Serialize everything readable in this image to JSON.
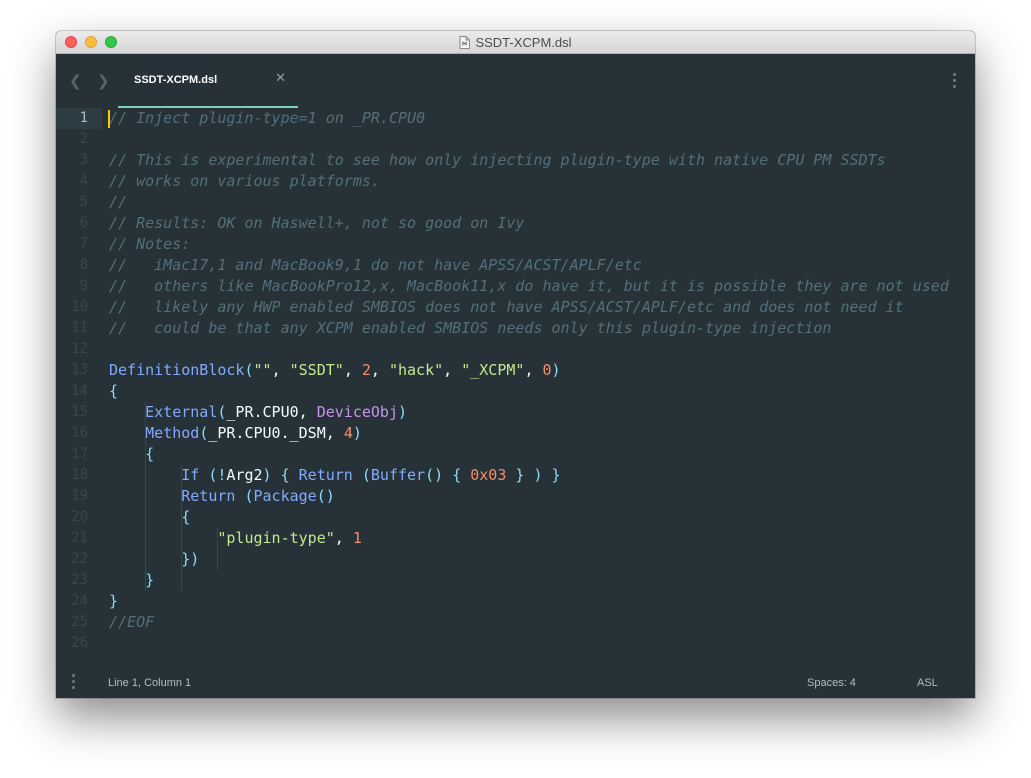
{
  "window": {
    "title": "SSDT-XCPM.dsl"
  },
  "tabs": [
    {
      "label": "SSDT-XCPM.dsl",
      "active": true
    }
  ],
  "icons": {
    "back": "chevron-left-icon",
    "forward": "chevron-right-icon",
    "close": "close-icon",
    "menu": "vertical-dots-icon"
  },
  "editor": {
    "current_line": 1,
    "line_numbers": [
      "1",
      "2",
      "3",
      "4",
      "5",
      "6",
      "7",
      "8",
      "9",
      "10",
      "11",
      "12",
      "13",
      "14",
      "15",
      "16",
      "17",
      "18",
      "19",
      "20",
      "21",
      "22",
      "23",
      "24",
      "25",
      "26"
    ],
    "lines": [
      "// Inject plugin-type=1 on _PR.CPU0",
      "",
      "// This is experimental to see how only injecting plugin-type with native CPU PM SSDTs",
      "// works on various platforms.",
      "//",
      "// Results: OK on Haswell+, not so good on Ivy",
      "// Notes:",
      "//   iMac17,1 and MacBook9,1 do not have APSS/ACST/APLF/etc",
      "//   others like MacBookPro12,x, MacBook11,x do have it, but it is possible they are not used",
      "//   likely any HWP enabled SMBIOS does not have APSS/ACST/APLF/etc and does not need it",
      "//   could be that any XCPM enabled SMBIOS needs only this plugin-type injection",
      "",
      "DefinitionBlock(\"\", \"SSDT\", 2, \"hack\", \"_XCPM\", 0)",
      "{",
      "    External(_PR.CPU0, DeviceObj)",
      "    Method(_PR.CPU0._DSM, 4)",
      "    {",
      "        If (!Arg2) { Return (Buffer() { 0x03 } ) }",
      "        Return (Package()",
      "        {",
      "            \"plugin-type\", 1",
      "        })",
      "    }",
      "}",
      "//EOF",
      ""
    ]
  },
  "status": {
    "position": "Line 1, Column 1",
    "indentation": "Spaces: 4",
    "syntax": "ASL"
  },
  "colors": {
    "background": "#263238",
    "comment": "#546e7a",
    "function": "#82aaff",
    "string": "#c3e88d",
    "number": "#f78c6c",
    "keyword": "#c792ea",
    "punctuation": "#89ddff",
    "tab_accent": "#80cbc4"
  }
}
